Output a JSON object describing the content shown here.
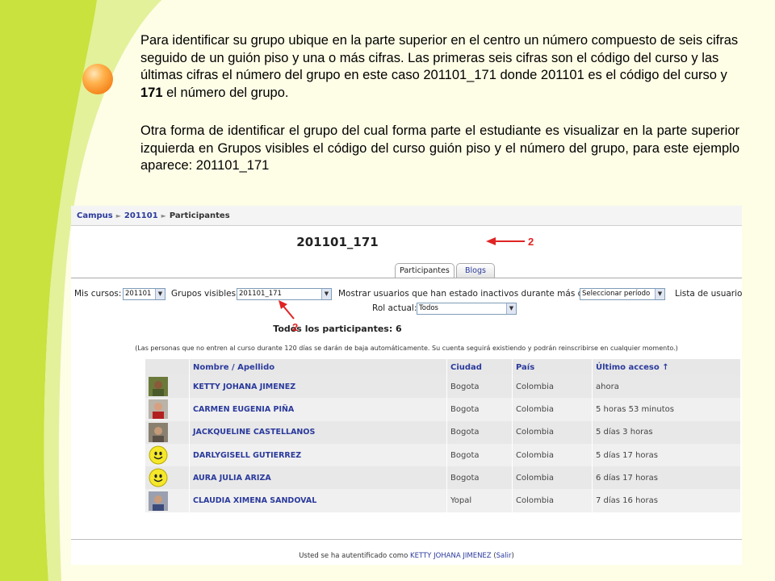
{
  "slide": {
    "paragraph1_a": "Para identificar su grupo ubique en la parte superior en el centro un número compuesto de seis cifras seguido de un guión piso y una o más cifras. Las primeras seis cifras son el código del curso y las últimas cifras el número del grupo en este caso 201101_171 donde 201101 es el código del curso y ",
    "paragraph1_bold": "171",
    "paragraph1_b": " el número del grupo.",
    "paragraph2": "Otra forma de identificar el grupo del cual forma parte el estudiante es visualizar en la parte superior izquierda en Grupos visibles el código del curso guión piso y el número del grupo, para este ejemplo aparece: 201101_171"
  },
  "breadcrumb": {
    "items": [
      "Campus",
      "201101",
      "Participantes"
    ],
    "separator": "►"
  },
  "group_title": "201101_171",
  "annotations": {
    "label_top": "2",
    "label_bottom": "2",
    "color": "#e02424"
  },
  "tabs": [
    {
      "label": "Participantes"
    },
    {
      "label": "Blogs"
    }
  ],
  "filters": {
    "my_courses_label": "Mis cursos:",
    "my_courses_value": "201101",
    "groups_label": "Grupos visibles:",
    "groups_value": "201101_171",
    "inactive_label": "Mostrar usuarios que han estado inactivos durante más de:",
    "inactive_value": "Seleccionar período",
    "list_label": "Lista de usuarios",
    "role_label": "Rol actual:",
    "role_value": "Todos"
  },
  "all_participants": "Todos los participantes: 6",
  "note": "(Las personas que no entren al curso durante 120 días se darán de baja automáticamente. Su cuenta seguirá existiendo y podrán reinscribirse en cualquier momento.)",
  "table": {
    "headers": [
      "Nombre / Apellido",
      "Ciudad",
      "País",
      "Último acceso ↑"
    ],
    "rows": [
      {
        "name": "KETTY JOHANA JIMENEZ",
        "city": "Bogota",
        "country": "Colombia",
        "last": "ahora",
        "avatar": "photo-green"
      },
      {
        "name": "CARMEN EUGENIA PIÑA",
        "city": "Bogota",
        "country": "Colombia",
        "last": "5 horas 53 minutos",
        "avatar": "photo-red"
      },
      {
        "name": "JACKQUELINE CASTELLANOS",
        "city": "Bogota",
        "country": "Colombia",
        "last": "5 días 3 horas",
        "avatar": "photo-gray"
      },
      {
        "name": "DARLYGISELL GUTIERREZ",
        "city": "Bogota",
        "country": "Colombia",
        "last": "5 días 17 horas",
        "avatar": "smiley"
      },
      {
        "name": "AURA JULIA ARIZA",
        "city": "Bogota",
        "country": "Colombia",
        "last": "6 días 17 horas",
        "avatar": "smiley"
      },
      {
        "name": "CLAUDIA XIMENA SANDOVAL",
        "city": "Yopal",
        "country": "Colombia",
        "last": "7 días 16 horas",
        "avatar": "photo-blue"
      }
    ]
  },
  "footer": {
    "prefix": "Usted se ha autentificado como ",
    "user": "KETTY JOHANA JIMENEZ",
    "logout": "Salir"
  },
  "colors": {
    "link": "#2a3a9c",
    "background": "#fefde6",
    "accent": "#cfe84a",
    "bullet": "#f5841c"
  }
}
